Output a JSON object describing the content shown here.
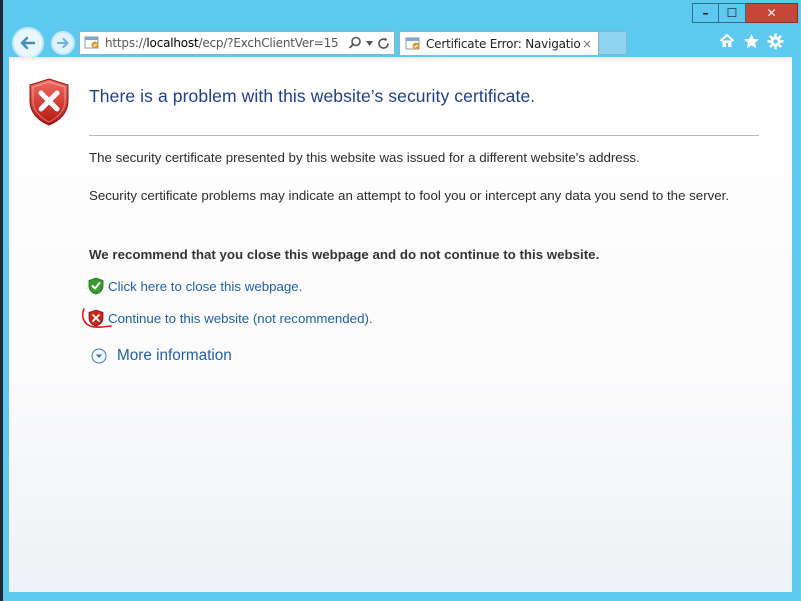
{
  "browser": {
    "address_url_prefix": "https://",
    "address_url_host": "localhost",
    "address_url_rest": "/ecp/?ExchClientVer=15",
    "tab_title": "Certificate Error: Navigation...",
    "tab_close": "×",
    "caption": {
      "minimize": "–",
      "maximize": "☐",
      "close": "✕"
    },
    "icons": [
      "back-arrow-icon",
      "forward-arrow-icon",
      "search-icon",
      "refresh-icon",
      "home-icon",
      "favorites-star-icon",
      "tools-gear-icon"
    ]
  },
  "page": {
    "heading": "There is a problem with this website’s security certificate.",
    "para1": "The security certificate presented by this website was issued for a different website's address.",
    "para2": "Security certificate problems may indicate an attempt to fool you or intercept any data you send to the server.",
    "recommend": "We recommend that you close this webpage and do not continue to this website.",
    "link_close": "Click here to close this webpage.",
    "link_continue": "Continue to this website (not recommended).",
    "more_info": "More information"
  },
  "colors": {
    "chrome": "#5ec9ee",
    "link": "#1f5fa8",
    "heading": "#1e3f8a",
    "close_button": "#c7463a",
    "annotation": "#e0141e"
  }
}
